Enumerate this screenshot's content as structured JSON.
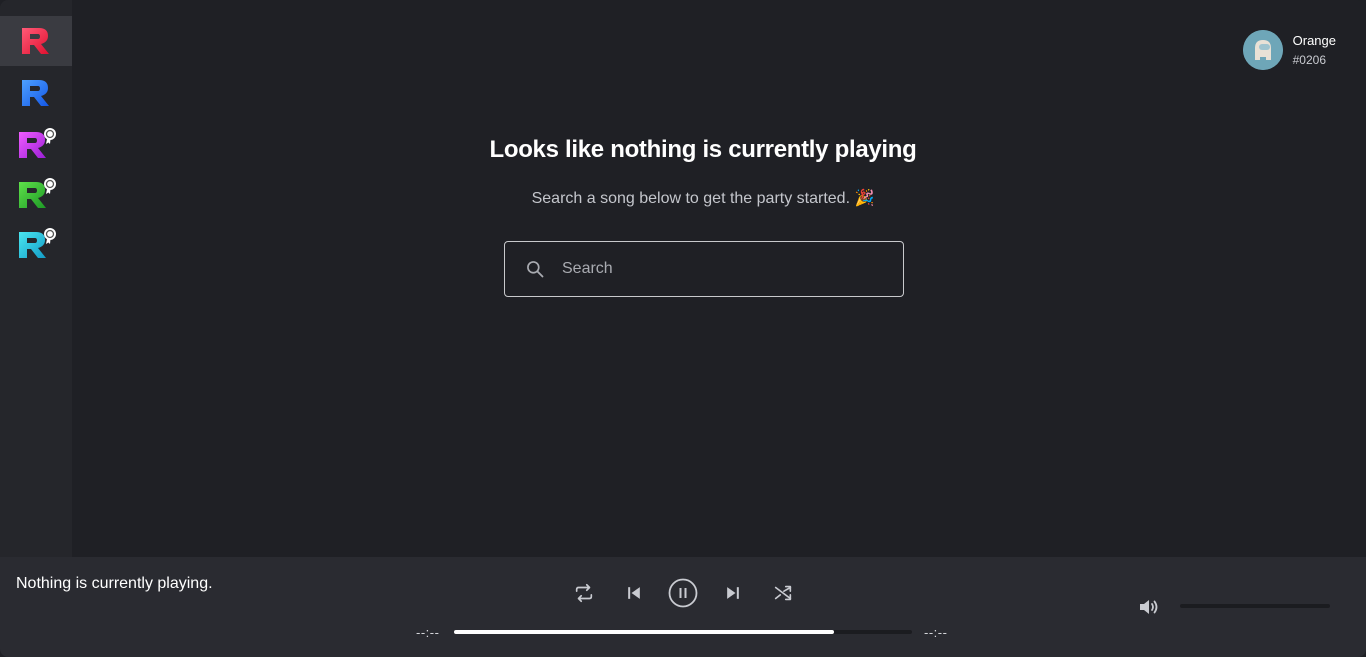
{
  "sidebar": {
    "bots": [
      {
        "name": "bot-red",
        "color_top": "#ff4466",
        "color_bottom": "#e0102f",
        "badge": false,
        "active": true
      },
      {
        "name": "bot-blue",
        "color_top": "#3a8dff",
        "color_bottom": "#1457e6",
        "badge": false,
        "active": false
      },
      {
        "name": "bot-purple",
        "color_top": "#e040fb",
        "color_bottom": "#9b1fd6",
        "badge": true,
        "active": false
      },
      {
        "name": "bot-green",
        "color_top": "#4cd137",
        "color_bottom": "#1e9a26",
        "badge": true,
        "active": false
      },
      {
        "name": "bot-cyan",
        "color_top": "#2fd8e6",
        "color_bottom": "#139cc7",
        "badge": true,
        "active": false
      }
    ]
  },
  "user": {
    "name": "Orange",
    "tag": "#0206"
  },
  "hero": {
    "title": "Looks like nothing is currently playing",
    "subtitle": "Search a song below to get the party started. 🎉"
  },
  "search": {
    "placeholder": "Search",
    "value": ""
  },
  "player": {
    "now_playing": "Nothing is currently playing.",
    "time_elapsed": "--:--",
    "time_total": "--:--",
    "progress_fraction": 0.83,
    "volume_fraction": 0.0,
    "icons": [
      "repeat-icon",
      "previous-icon",
      "pause-icon",
      "next-icon",
      "shuffle-icon",
      "volume-icon"
    ]
  },
  "colors": {
    "background": "#1f2025",
    "sidebar": "#25262b",
    "player_bar": "#2a2b31",
    "accent": "#ffffff"
  }
}
